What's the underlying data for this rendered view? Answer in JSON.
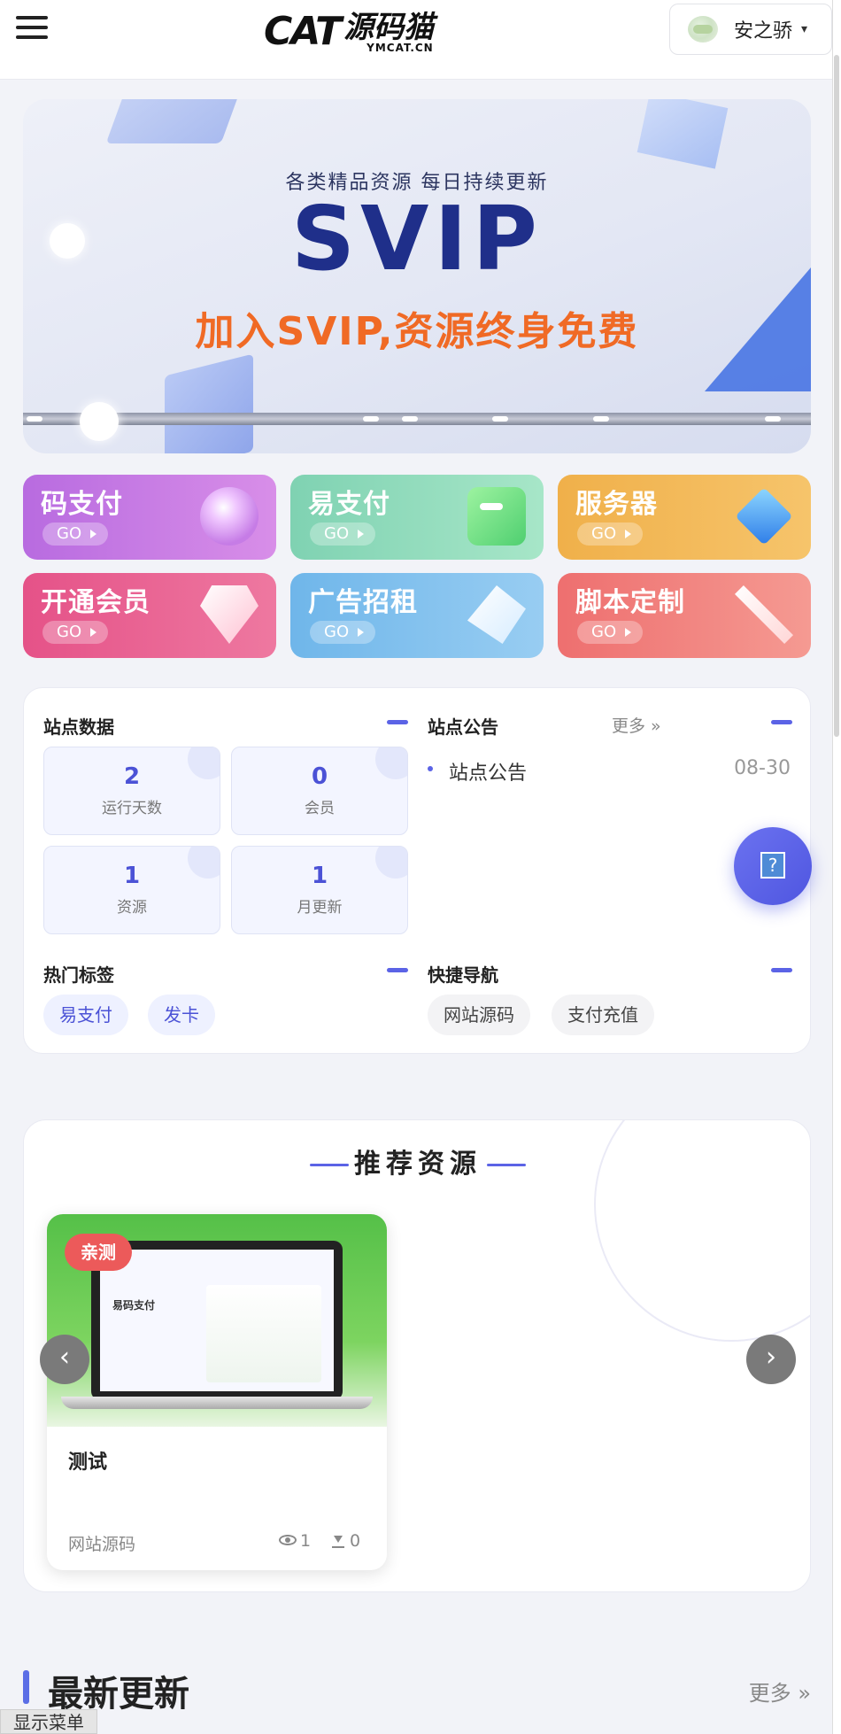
{
  "header": {
    "logo_brand": "CAT",
    "logo_cn": "源码猫",
    "logo_domain": "YMCAT.CN",
    "user_name": "安之骄",
    "caret": "▾"
  },
  "banner": {
    "subtitle": "各类精品资源  每日持续更新",
    "headline": "SVIP",
    "slogan": "加入SVIP,资源终身免费"
  },
  "quick_cards": [
    {
      "title": "码支付",
      "go": "GO"
    },
    {
      "title": "易支付",
      "go": "GO"
    },
    {
      "title": "服务器",
      "go": "GO"
    },
    {
      "title": "开通会员",
      "go": "GO"
    },
    {
      "title": "广告招租",
      "go": "GO"
    },
    {
      "title": "脚本定制",
      "go": "GO"
    }
  ],
  "site_data": {
    "title": "站点数据",
    "stats": [
      {
        "value": "2",
        "label": "运行天数"
      },
      {
        "value": "0",
        "label": "会员"
      },
      {
        "value": "1",
        "label": "资源"
      },
      {
        "value": "1",
        "label": "月更新"
      }
    ]
  },
  "notices": {
    "title": "站点公告",
    "more": "更多 »",
    "items": [
      {
        "text": "站点公告",
        "date": "08-30"
      }
    ]
  },
  "hot_tags": {
    "title": "热门标签",
    "items": [
      "易支付",
      "发卡"
    ]
  },
  "quick_nav": {
    "title": "快捷导航",
    "items": [
      "网站源码",
      "支付充值"
    ]
  },
  "help_icon": "?",
  "recommend": {
    "title": "推荐资源",
    "prev": "‹",
    "next": "›",
    "card": {
      "badge": "亲测",
      "screen_text": "易码支付",
      "title": "测试",
      "category": "网站源码",
      "views": "1",
      "downloads": "0"
    }
  },
  "latest": {
    "title": "最新更新",
    "more": "更多 »"
  },
  "show_menu": "显示菜单",
  "colors": {
    "accent": "#5b63e6",
    "badge": "#ec5a5a",
    "slogan": "#f06a25"
  }
}
